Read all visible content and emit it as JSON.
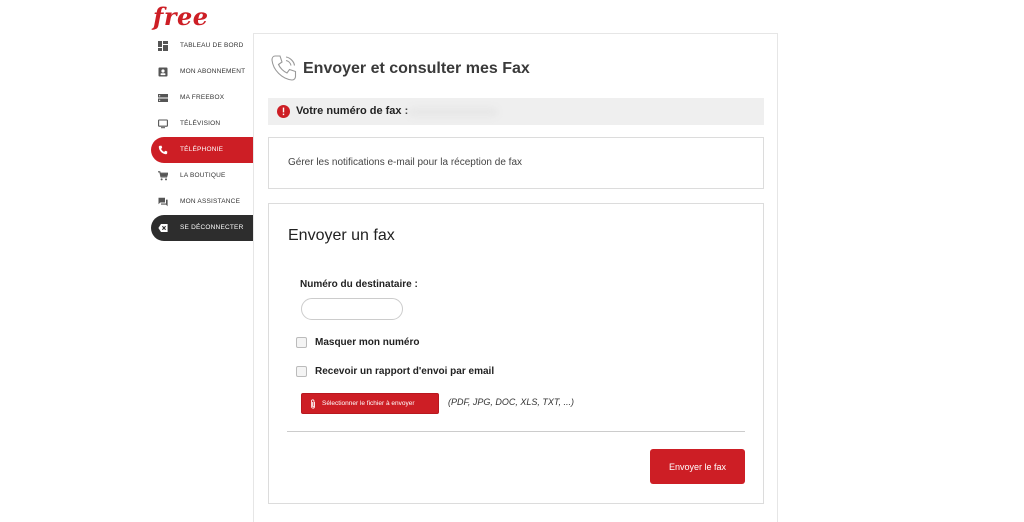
{
  "brand": {
    "logo_text": "free",
    "accent_color": "#cd1e25"
  },
  "sidebar": {
    "items": [
      {
        "label": "TABLEAU DE BORD",
        "icon": "dashboard-icon"
      },
      {
        "label": "MON ABONNEMENT",
        "icon": "account-icon"
      },
      {
        "label": "MA FREEBOX",
        "icon": "freebox-icon"
      },
      {
        "label": "TÉLÉVISION",
        "icon": "tv-icon"
      },
      {
        "label": "TÉLÉPHONIE",
        "icon": "phone-icon",
        "active": true
      },
      {
        "label": "LA BOUTIQUE",
        "icon": "cart-icon"
      },
      {
        "label": "MON ASSISTANCE",
        "icon": "chat-icon"
      },
      {
        "label": "SE DÉCONNECTER",
        "icon": "logout-icon"
      }
    ]
  },
  "header": {
    "title": "Envoyer et consulter mes Fax",
    "icon": "fax-phone-icon"
  },
  "fax_number": {
    "label": "Votre numéro de fax :",
    "icon": "info-icon"
  },
  "notifications": {
    "link_text": "Gérer les notifications e-mail pour la réception de fax"
  },
  "send_fax": {
    "title": "Envoyer un fax",
    "recipient_label": "Numéro du destinataire :",
    "recipient_value": "",
    "hide_number_label": "Masquer mon numéro",
    "report_label": "Recevoir un rapport d'envoi par email",
    "file_button_label": "Sélectionner le fichier à envoyer",
    "file_types": "(PDF, JPG, DOC, XLS, TXT, ...)",
    "submit_label": "Envoyer le fax"
  }
}
